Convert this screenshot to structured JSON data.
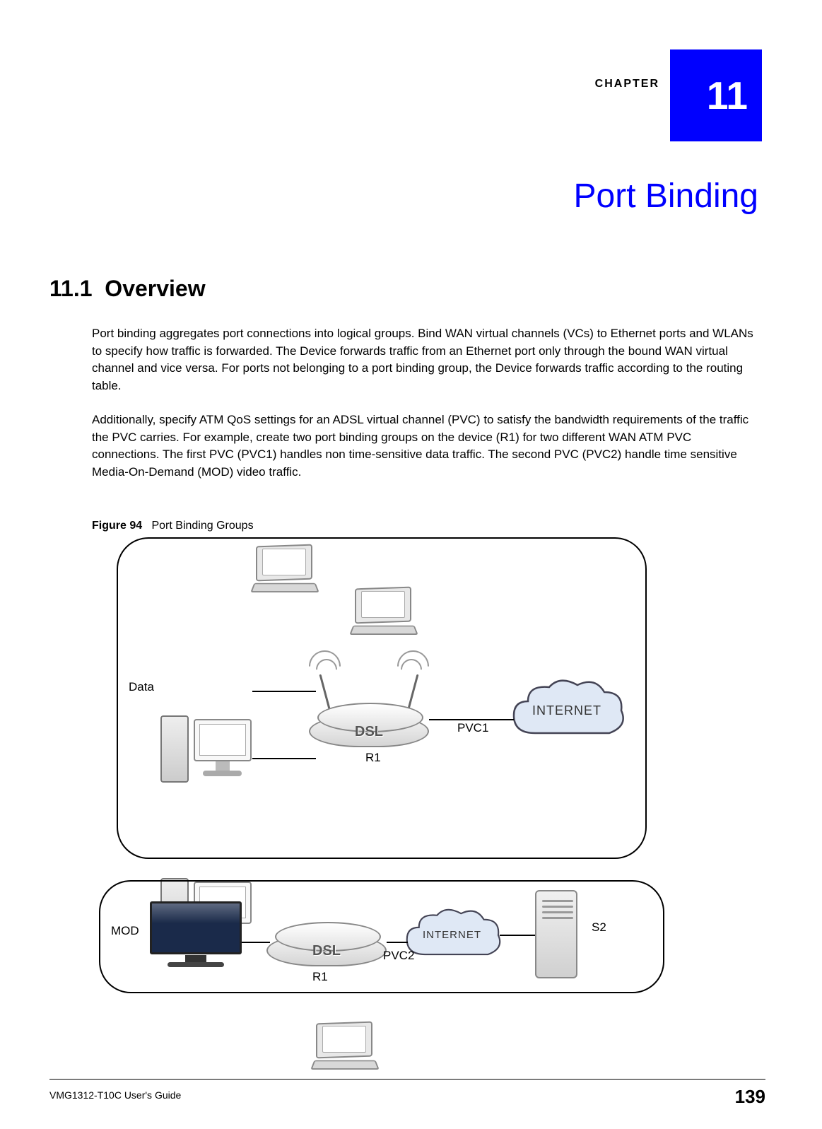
{
  "chapter": {
    "label": "CHAPTER",
    "number": "11",
    "title": "Port Binding"
  },
  "section": {
    "number": "11.1",
    "heading": "Overview"
  },
  "paragraphs": {
    "p1": "Port binding aggregates port connections into logical groups. Bind WAN virtual channels (VCs) to Ethernet ports and WLANs to specify how traffic is forwarded. The Device forwards traffic from an Ethernet port only through the bound WAN virtual channel and vice versa. For ports not belonging to a port binding group, the Device forwards traffic according to the routing table.",
    "p2": "Additionally, specify ATM QoS settings for an ADSL virtual channel (PVC) to satisfy the bandwidth requirements of the traffic the PVC carries. For example, create two port binding groups on the device (R1) for two different WAN ATM PVC connections. The first PVC (PVC1) handles non time-sensitive data traffic. The second PVC (PVC2) handle time sensitive Media-On-Demand (MOD) video traffic."
  },
  "figure": {
    "label": "Figure 94",
    "caption": "Port Binding Groups"
  },
  "diagram": {
    "top": {
      "group_label": "Data",
      "router_label": "R1",
      "link_label": "PVC1",
      "cloud_label": "INTERNET",
      "dsl_text": "DSL"
    },
    "bottom": {
      "group_label": "MOD",
      "router_label": "R1",
      "link_label": "PVC2",
      "cloud_label": "INTERNET",
      "server_label": "S2",
      "dsl_text": "DSL"
    }
  },
  "footer": {
    "guide": "VMG1312-T10C User's Guide",
    "page": "139"
  }
}
